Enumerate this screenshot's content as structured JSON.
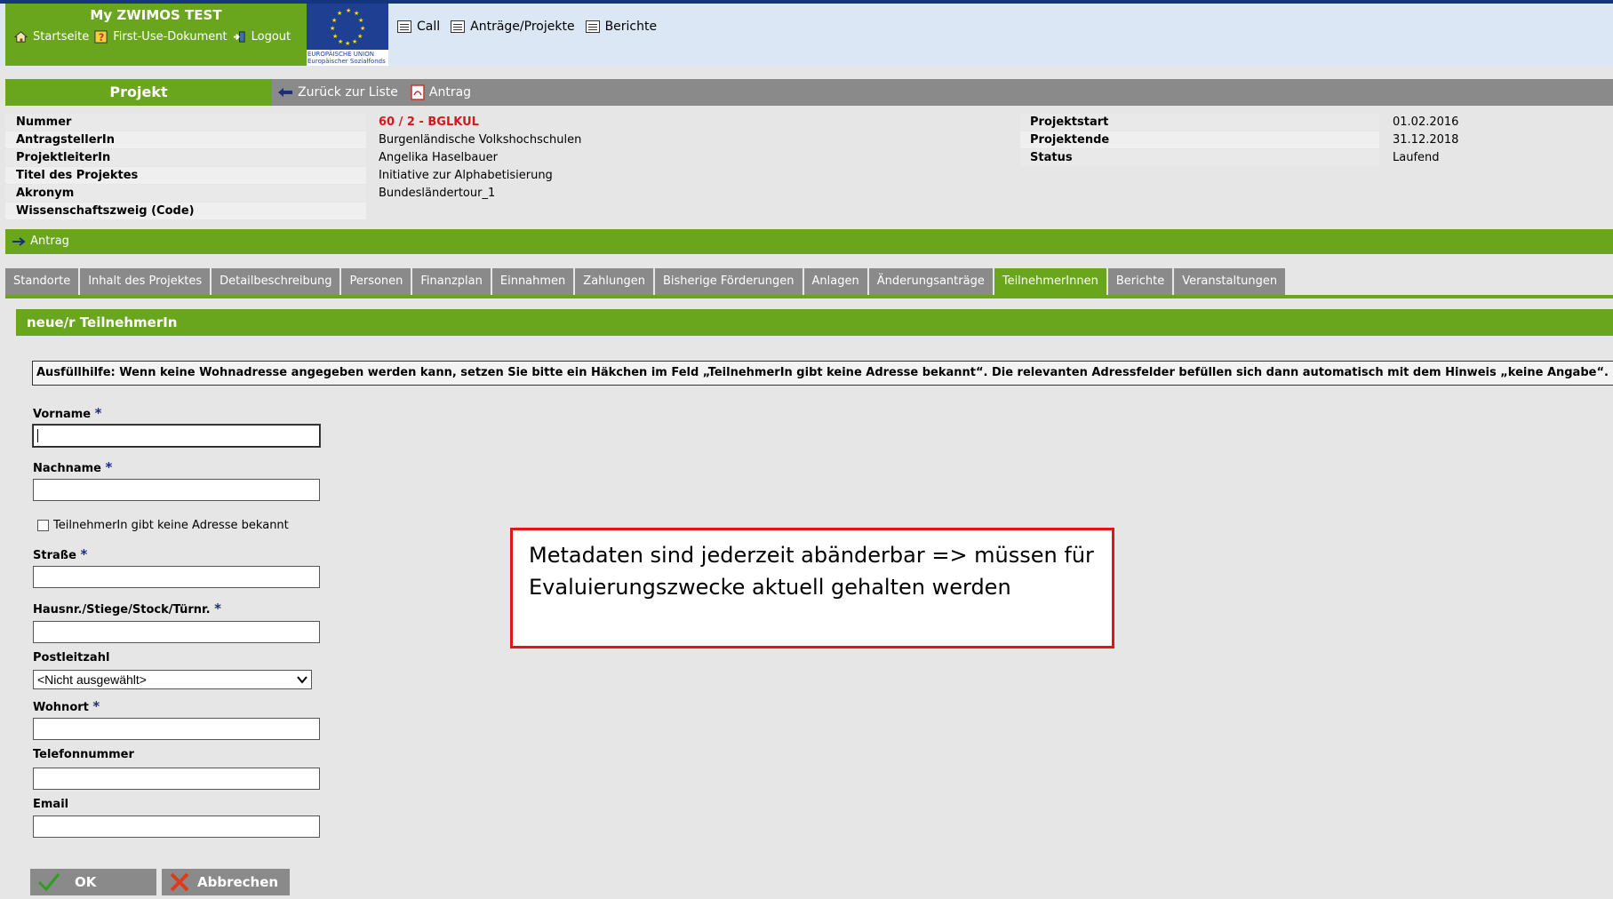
{
  "header": {
    "app_title": "My ZWIMOS TEST",
    "links": [
      "Startseite",
      "First-Use-Dokument",
      "Logout"
    ],
    "eu_text_1": "EUROPÄISCHE UNION",
    "eu_text_2": "Europäischer Sozialfonds",
    "nav": [
      "Call",
      "Anträge/Projekte",
      "Berichte"
    ]
  },
  "project_bar": {
    "title": "Projekt",
    "back_label": "Zurück zur Liste",
    "antrag_label": "Antrag"
  },
  "project_info": {
    "left": [
      {
        "label": "Nummer",
        "value": "60 / 2 - BGLKUL"
      },
      {
        "label": "AntragstellerIn",
        "value": "Burgenländische Volkshochschulen"
      },
      {
        "label": "ProjektleiterIn",
        "value": "Angelika Haselbauer"
      },
      {
        "label": "Titel des Projektes",
        "value": "Initiative zur Alphabetisierung"
      },
      {
        "label": "Akronym",
        "value": "Bundesländertour_1"
      },
      {
        "label": "Wissenschaftszweig (Code)",
        "value": ""
      }
    ],
    "right": [
      {
        "label": "Projektstart",
        "value": "01.02.2016"
      },
      {
        "label": "Projektende",
        "value": "31.12.2018"
      },
      {
        "label": "Status",
        "value": "Laufend"
      }
    ]
  },
  "antrag_bar": "Antrag",
  "tabs": [
    "Standorte",
    "Inhalt des Projektes",
    "Detailbeschreibung",
    "Personen",
    "Finanzplan",
    "Einnahmen",
    "Zahlungen",
    "Bisherige Förderungen",
    "Anlagen",
    "Änderungsanträge",
    "TeilnehmerInnen",
    "Berichte",
    "Veranstaltungen"
  ],
  "active_tab": "TeilnehmerInnen",
  "form": {
    "title": "neue/r TeilnehmerIn",
    "hint": "Ausfüllhilfe: Wenn keine Wohnadresse angegeben werden kann, setzen Sie bitte ein Häkchen im Feld „TeilnehmerIn gibt keine Adresse bekannt“. Die relevanten Adressfelder befüllen sich dann automatisch mit dem Hinweis „keine Angabe“.",
    "vorname_label": "Vorname",
    "nachname_label": "Nachname",
    "no_address_label": "TeilnehmerIn gibt keine Adresse bekannt",
    "strasse_label": "Straße",
    "hausnr_label": "Hausnr./Stiege/Stock/Türnr.",
    "plz_label": "Postleitzahl",
    "plz_value": "<Nicht ausgewählt>",
    "wohnort_label": "Wohnort",
    "telefon_label": "Telefonnummer",
    "email_label": "Email",
    "required_mark": "*",
    "ok_label": "OK",
    "cancel_label": "Abbrechen"
  },
  "callout": "Metadaten sind jederzeit abänderbar => müssen für Evaluierungszwecke aktuell gehalten werden",
  "colors": {
    "green": "#6aa51e",
    "gray": "#8a8a8a",
    "navy": "#16357f",
    "red": "#d9161d"
  }
}
